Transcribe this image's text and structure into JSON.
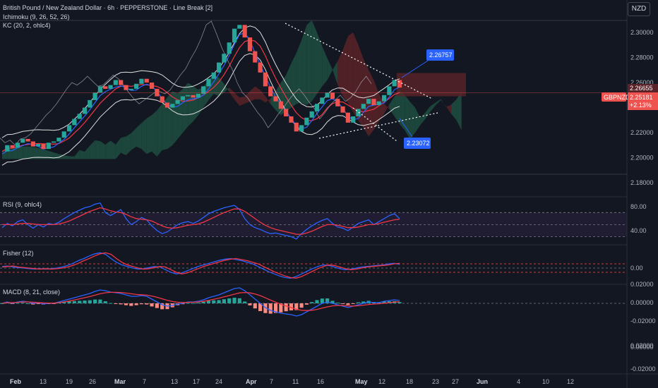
{
  "header": {
    "symbol_title": "British Pound / New Zealand Dollar · 6h · PEPPERSTONE · Line Break [2]",
    "ichimoku_label": "Ichimoku (9, 26, 52, 26)",
    "kc_label": "KC (20, 2, ohlc4)",
    "currency_button": "NZD"
  },
  "panes": {
    "rsi_label": "RSI (9, ohlc4)",
    "fisher_label": "Fisher (12)",
    "macd_label": "MACD (8, 21, close)"
  },
  "colors": {
    "background": "#131722",
    "up": "#26a69a",
    "down": "#ef5350",
    "blue": "#2962ff",
    "red": "#f23645",
    "kumo_green": "#1e4d40",
    "kumo_red": "#5a2328",
    "callout": "#2962ff",
    "rsi_band": "#2a2140",
    "text": "#d1d4dc",
    "grid_axis": "#787b86"
  },
  "chart_data": {
    "type": "line",
    "title": "British Pound / New Zealand Dollar · 6h · PEPPERSTONE · Line Break [2]",
    "price_axis": {
      "ticks": [
        "2.30000",
        "2.28000",
        "2.26000",
        "2.24000",
        "2.22000",
        "2.20000",
        "2.18000"
      ],
      "ylim": [
        2.175,
        2.318
      ]
    },
    "price_labels": {
      "ref_price": "2.26655",
      "symbol_tag": "GBPNZD",
      "last_price": "2.25181",
      "change": "+2.13%"
    },
    "callouts": {
      "upper": "2.26757",
      "lower": "2.23072"
    },
    "x_axis": {
      "ticks": [
        "Feb",
        "13",
        "19",
        "26",
        "Mar",
        "7",
        "13",
        "17",
        "24",
        "Apr",
        "7",
        "11",
        "16",
        "May",
        "12",
        "18",
        "23",
        "27",
        "Jun",
        "4",
        "10",
        "12"
      ],
      "month_ticks": [
        "Feb",
        "Mar",
        "Apr",
        "May",
        "Jun"
      ]
    },
    "price_series": [
      2.205,
      2.21,
      2.208,
      2.212,
      2.215,
      2.213,
      2.209,
      2.211,
      2.207,
      2.212,
      2.213,
      2.216,
      2.221,
      2.226,
      2.231,
      2.235,
      2.24,
      2.246,
      2.252,
      2.257,
      2.255,
      2.258,
      2.262,
      2.258,
      2.254,
      2.255,
      2.259,
      2.263,
      2.26,
      2.255,
      2.249,
      2.244,
      2.24,
      2.243,
      2.246,
      2.249,
      2.25,
      2.248,
      2.251,
      2.257,
      2.263,
      2.268,
      2.276,
      2.283,
      2.292,
      2.303,
      2.306,
      2.296,
      2.285,
      2.276,
      2.268,
      2.257,
      2.249,
      2.245,
      2.239,
      2.233,
      2.228,
      2.221,
      2.226,
      2.232,
      2.237,
      2.243,
      2.248,
      2.252,
      2.247,
      2.241,
      2.236,
      2.228,
      2.233,
      2.239,
      2.243,
      2.247,
      2.242,
      2.245,
      2.25,
      2.257,
      2.262,
      2.256
    ],
    "rsi": {
      "ticks": [
        "80.00",
        "40.00"
      ],
      "levels": [
        70,
        50,
        30
      ],
      "ylim": [
        20,
        95
      ],
      "rsi_line": [
        45,
        52,
        48,
        55,
        58,
        50,
        44,
        50,
        46,
        52,
        50,
        54,
        60,
        65,
        70,
        74,
        78,
        80,
        84,
        86,
        70,
        65,
        70,
        75,
        60,
        50,
        55,
        62,
        58,
        48,
        40,
        35,
        38,
        44,
        50,
        53,
        55,
        52,
        56,
        62,
        68,
        72,
        75,
        78,
        80,
        82,
        75,
        60,
        50,
        45,
        42,
        38,
        35,
        36,
        34,
        32,
        30,
        26,
        35,
        42,
        48,
        53,
        57,
        60,
        52,
        46,
        44,
        40,
        46,
        52,
        55,
        58,
        50,
        55,
        60,
        65,
        68,
        60
      ],
      "signal_line": [
        50,
        50,
        50,
        51,
        52,
        52,
        51,
        50,
        50,
        50,
        50,
        51,
        53,
        56,
        60,
        64,
        68,
        72,
        75,
        78,
        76,
        73,
        71,
        70,
        67,
        63,
        60,
        59,
        58,
        56,
        52,
        48,
        45,
        44,
        45,
        47,
        49,
        50,
        51,
        54,
        58,
        62,
        66,
        70,
        73,
        76,
        76,
        72,
        66,
        60,
        54,
        49,
        45,
        42,
        40,
        38,
        36,
        34,
        34,
        36,
        39,
        43,
        47,
        50,
        50,
        49,
        47,
        45,
        45,
        46,
        48,
        50,
        50,
        52,
        54,
        56,
        58,
        59
      ]
    },
    "fisher": {
      "ticks": [
        "0.00"
      ],
      "ylim": [
        -2.4,
        3.2
      ],
      "fisher_line": [
        0.3,
        0.4,
        0.2,
        0.1,
        0.0,
        -0.1,
        -0.2,
        -0.1,
        -0.2,
        -0.1,
        0.0,
        0.2,
        0.5,
        0.9,
        1.4,
        1.8,
        2.3,
        2.7,
        2.9,
        2.6,
        1.8,
        1.1,
        0.6,
        0.3,
        0.0,
        -0.2,
        -0.1,
        0.1,
        0.3,
        0.2,
        -0.3,
        -0.8,
        -1.1,
        -0.9,
        -0.5,
        -0.1,
        0.3,
        0.6,
        0.9,
        1.2,
        1.5,
        1.7,
        1.8,
        1.6,
        1.4,
        1.1,
        0.8,
        0.3,
        -0.2,
        -0.7,
        -1.1,
        -1.5,
        -1.8,
        -1.9,
        -1.6,
        -1.1,
        -0.6,
        -0.1,
        0.3,
        0.6,
        0.5,
        0.2,
        -0.1,
        -0.3,
        -0.2,
        0.0,
        0.2,
        0.3,
        0.4,
        0.5,
        0.6,
        0.8,
        0.9,
        0.7
      ],
      "trigger_line": [
        0.2,
        0.3,
        0.4,
        0.2,
        0.1,
        0.0,
        -0.1,
        -0.2,
        -0.1,
        -0.2,
        -0.1,
        0.0,
        0.2,
        0.5,
        0.9,
        1.4,
        1.8,
        2.3,
        2.7,
        2.9,
        2.6,
        1.8,
        1.1,
        0.6,
        0.3,
        0.0,
        -0.2,
        -0.1,
        0.1,
        0.3,
        0.2,
        -0.3,
        -0.8,
        -1.1,
        -0.9,
        -0.5,
        -0.1,
        0.3,
        0.6,
        0.9,
        1.2,
        1.5,
        1.7,
        1.8,
        1.6,
        1.4,
        1.1,
        0.8,
        0.3,
        -0.2,
        -0.7,
        -1.1,
        -1.5,
        -1.8,
        -1.9,
        -1.6,
        -1.1,
        -0.6,
        -0.1,
        0.3,
        0.6,
        0.5,
        0.2,
        -0.1,
        -0.3,
        -0.2,
        0.0,
        0.2,
        0.3,
        0.4,
        0.5,
        0.6,
        0.8,
        0.9
      ]
    },
    "macd": {
      "ticks": [
        "0.02000",
        "0.00000",
        "-0.02000",
        "0.02000",
        "0.00000",
        "-0.02000"
      ],
      "ylim": [
        -0.014,
        0.013
      ],
      "macd_line": [
        0.0,
        0.001,
        0.0,
        0.001,
        0.0015,
        0.001,
        0.0,
        0.0005,
        -0.0005,
        0.0,
        0.0,
        0.001,
        0.002,
        0.003,
        0.004,
        0.005,
        0.006,
        0.007,
        0.0085,
        0.0095,
        0.009,
        0.008,
        0.0075,
        0.007,
        0.006,
        0.005,
        0.005,
        0.0055,
        0.005,
        0.003,
        0.001,
        -0.001,
        -0.002,
        -0.0015,
        -0.0005,
        0.0,
        0.001,
        0.001,
        0.0015,
        0.0025,
        0.004,
        0.005,
        0.006,
        0.0075,
        0.009,
        0.0105,
        0.011,
        0.009,
        0.006,
        0.003,
        0.0,
        -0.003,
        -0.005,
        -0.006,
        -0.007,
        -0.0075,
        -0.008,
        -0.009,
        -0.008,
        -0.006,
        -0.004,
        -0.002,
        0.0,
        0.001,
        0.0,
        -0.001,
        -0.002,
        -0.003,
        -0.002,
        -0.001,
        0.0,
        0.001,
        0.0005,
        0.0005,
        0.0015,
        0.002,
        0.0025,
        0.002
      ],
      "signal_line": [
        0.0,
        0.0005,
        0.0005,
        0.0007,
        0.001,
        0.001,
        0.0008,
        0.0006,
        0.0003,
        0.0002,
        0.0002,
        0.0005,
        0.001,
        0.0016,
        0.0024,
        0.0032,
        0.004,
        0.0048,
        0.0058,
        0.0068,
        0.0075,
        0.0078,
        0.0078,
        0.0077,
        0.0073,
        0.0068,
        0.0063,
        0.0061,
        0.0058,
        0.0052,
        0.0043,
        0.0032,
        0.0021,
        0.0013,
        0.0008,
        0.0006,
        0.0007,
        0.0008,
        0.001,
        0.0014,
        0.0021,
        0.0029,
        0.0037,
        0.0046,
        0.0055,
        0.0065,
        0.0074,
        0.0077,
        0.0074,
        0.0066,
        0.0055,
        0.0039,
        0.0023,
        0.0008,
        -0.0006,
        -0.0019,
        -0.003,
        -0.0042,
        -0.0049,
        -0.0051,
        -0.0049,
        -0.0043,
        -0.0034,
        -0.0025,
        -0.0018,
        -0.0015,
        -0.0015,
        -0.0018,
        -0.0019,
        -0.0017,
        -0.0013,
        -0.0008,
        -0.0005,
        -0.0003,
        0.0001,
        0.0005,
        0.0009,
        0.0011
      ]
    }
  }
}
